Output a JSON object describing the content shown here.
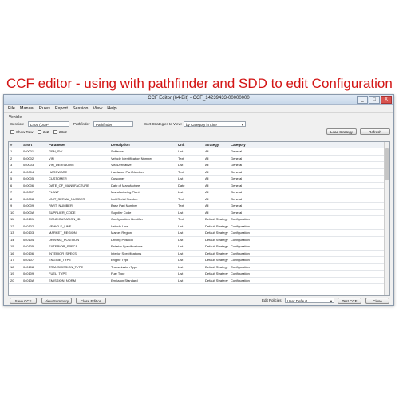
{
  "headline": "CCF editor - using with pathfinder and SDD to edit Configuration",
  "window": {
    "title": "CCF Editor (64-Bit) - CCF_14239433-00000000",
    "controls": [
      "_",
      "□",
      "X"
    ]
  },
  "menu": [
    "File",
    "Manual",
    "Rules",
    "Export",
    "Session",
    "View",
    "Help"
  ],
  "vehicle": {
    "section_label": "Vehicle",
    "session_label": "Session:",
    "session_value": "L405 (DoIP)",
    "pathfinder_label": "Pathfinder",
    "pathfinder_value": "Pathfinder",
    "sort_label": "Sort Strategies to View:",
    "sort_value": "by Category in Line",
    "show_raw_label": "Show Raw",
    "opt_2x2_label": "2x2",
    "opt_28x2_label": "28x2",
    "load_strategy_label": "Load Strategy",
    "refresh_label": "Refresh"
  },
  "table": {
    "columns": [
      "#",
      "Short",
      "Parameter",
      "Description",
      "Unit",
      "Strategy",
      "Category"
    ],
    "rows": [
      [
        "1",
        "0x0001",
        "GEN_SW",
        "Software",
        "List",
        "All",
        "General"
      ],
      [
        "2",
        "0x0002",
        "VIN",
        "Vehicle Identification Number",
        "Text",
        "All",
        "General"
      ],
      [
        "3",
        "0x0003",
        "VIN_DERIVATIVE",
        "VIN Derivative",
        "List",
        "All",
        "General"
      ],
      [
        "4",
        "0x0004",
        "HARDWARE",
        "Hardware Part Number",
        "Text",
        "All",
        "General"
      ],
      [
        "5",
        "0x0005",
        "CUSTOMER",
        "Customer",
        "List",
        "All",
        "General"
      ],
      [
        "6",
        "0x0006",
        "DATE_OF_MANUFACTURE",
        "Date of Manufacture",
        "Date",
        "All",
        "General"
      ],
      [
        "7",
        "0x0007",
        "PLANT",
        "Manufacturing Plant",
        "List",
        "All",
        "General"
      ],
      [
        "8",
        "0x0008",
        "UNIT_SERIAL_NUMBER",
        "Unit Serial Number",
        "Text",
        "All",
        "General"
      ],
      [
        "9",
        "0x0009",
        "PART_NUMBER",
        "Base Part Number",
        "Text",
        "All",
        "General"
      ],
      [
        "10",
        "0x000A",
        "SUPPLIER_CODE",
        "Supplier Code",
        "List",
        "All",
        "General"
      ],
      [
        "11",
        "0x0101",
        "CONFIGURATION_ID",
        "Configuration Identifier",
        "Text",
        "Default Strategy",
        "Configuration"
      ],
      [
        "12",
        "0x0102",
        "VEHICLE_LINE",
        "Vehicle Line",
        "List",
        "Default Strategy",
        "Configuration"
      ],
      [
        "13",
        "0x0103",
        "MARKET_REGION",
        "Market Region",
        "List",
        "Default Strategy",
        "Configuration"
      ],
      [
        "14",
        "0x0104",
        "DRIVING_POSITION",
        "Driving Position",
        "List",
        "Default Strategy",
        "Configuration"
      ],
      [
        "15",
        "0x0105",
        "EXTERIOR_SPECS",
        "Exterior Specifications",
        "List",
        "Default Strategy",
        "Configuration"
      ],
      [
        "16",
        "0x0106",
        "INTERIOR_SPECS",
        "Interior Specifications",
        "List",
        "Default Strategy",
        "Configuration"
      ],
      [
        "17",
        "0x0107",
        "ENGINE_TYPE",
        "Engine Type",
        "List",
        "Default Strategy",
        "Configuration"
      ],
      [
        "18",
        "0x0108",
        "TRANSMISSION_TYPE",
        "Transmission Type",
        "List",
        "Default Strategy",
        "Configuration"
      ],
      [
        "19",
        "0x0109",
        "FUEL_TYPE",
        "Fuel Type",
        "List",
        "Default Strategy",
        "Configuration"
      ],
      [
        "20",
        "0x010A",
        "EMISSION_NORM",
        "Emission Standard",
        "List",
        "Default Strategy",
        "Configuration"
      ]
    ]
  },
  "footer": {
    "save_ccf_label": "Save CCF",
    "view_summary_label": "View Summary",
    "close_edition_label": "Close Edition",
    "edit_policies_label": "Edit Policies:",
    "edit_policies_value": "User Default",
    "test_ccf_label": "Test CCF",
    "close_label": "Close"
  }
}
